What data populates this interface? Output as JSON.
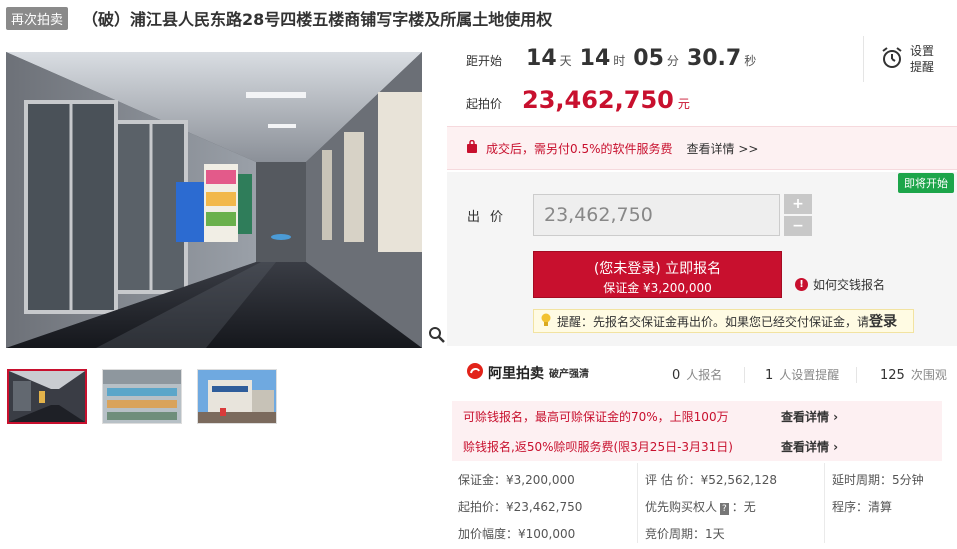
{
  "header": {
    "tag": "再次拍卖",
    "title": "（破）浦江县人民东路28号四楼五楼商铺写字楼及所属土地使用权"
  },
  "countdown": {
    "label": "距开始",
    "days": "14",
    "days_unit": "天",
    "hours": "14",
    "hours_unit": "时",
    "minutes": "05",
    "minutes_unit": "分",
    "seconds": "30.7",
    "seconds_unit": "秒"
  },
  "reminder": {
    "label": "设置提醒",
    "icon": "alarm-clock-icon"
  },
  "start_price": {
    "label": "起拍价",
    "value": "23,462,750",
    "unit": "元"
  },
  "notice": {
    "text": "成交后，需另付0.5%的软件服务费",
    "link": "查看详情 >>",
    "icon": "bag-icon"
  },
  "bid": {
    "badge": "即将开始",
    "label": "出价",
    "input_value": "23,462,750",
    "plus": "+",
    "minus": "−",
    "signup_main": "(您未登录) 立即报名",
    "signup_sub": "保证金 ¥3,200,000",
    "how_link": "如何交钱报名",
    "tip_text": "提醒：先报名交保证金再出价。如果您已经交付保证金，请",
    "tip_strong": "登录"
  },
  "brand": {
    "name": "阿里拍卖",
    "sub": "破产强清"
  },
  "stats": [
    {
      "num": "0",
      "label": "人报名"
    },
    {
      "num": "1",
      "label": "人设置提醒"
    },
    {
      "num": "125",
      "label": "次围观"
    }
  ],
  "promos": [
    {
      "text": "可赊钱报名，最高可赊保证金的70%，上限100万",
      "link": "查看详情 ›"
    },
    {
      "text": "赊钱报名,返50%赊呗服务费(限3月25日-3月31日)",
      "link": "查看详情 ›"
    }
  ],
  "specs": {
    "deposit": {
      "label": "保证金：",
      "value": "¥3,200,000"
    },
    "start": {
      "label": "起拍价：",
      "value": "¥23,462,750"
    },
    "increment": {
      "label": "加价幅度：",
      "value": "¥100,000"
    },
    "appraisal": {
      "label": "评 估 价：",
      "value": "¥52,562,128"
    },
    "priority": {
      "label": "优先购买权人",
      "badge": "?",
      "value": "：无"
    },
    "cycle": {
      "label": "竞价周期：",
      "value": "1天"
    },
    "delay": {
      "label": "延时周期：",
      "value": "5分钟"
    },
    "procedure": {
      "label": "程序：",
      "value": "清算"
    }
  },
  "colors": {
    "accent": "#c8102e",
    "green": "#1da54a",
    "grey_badge": "#8a8a8a"
  }
}
